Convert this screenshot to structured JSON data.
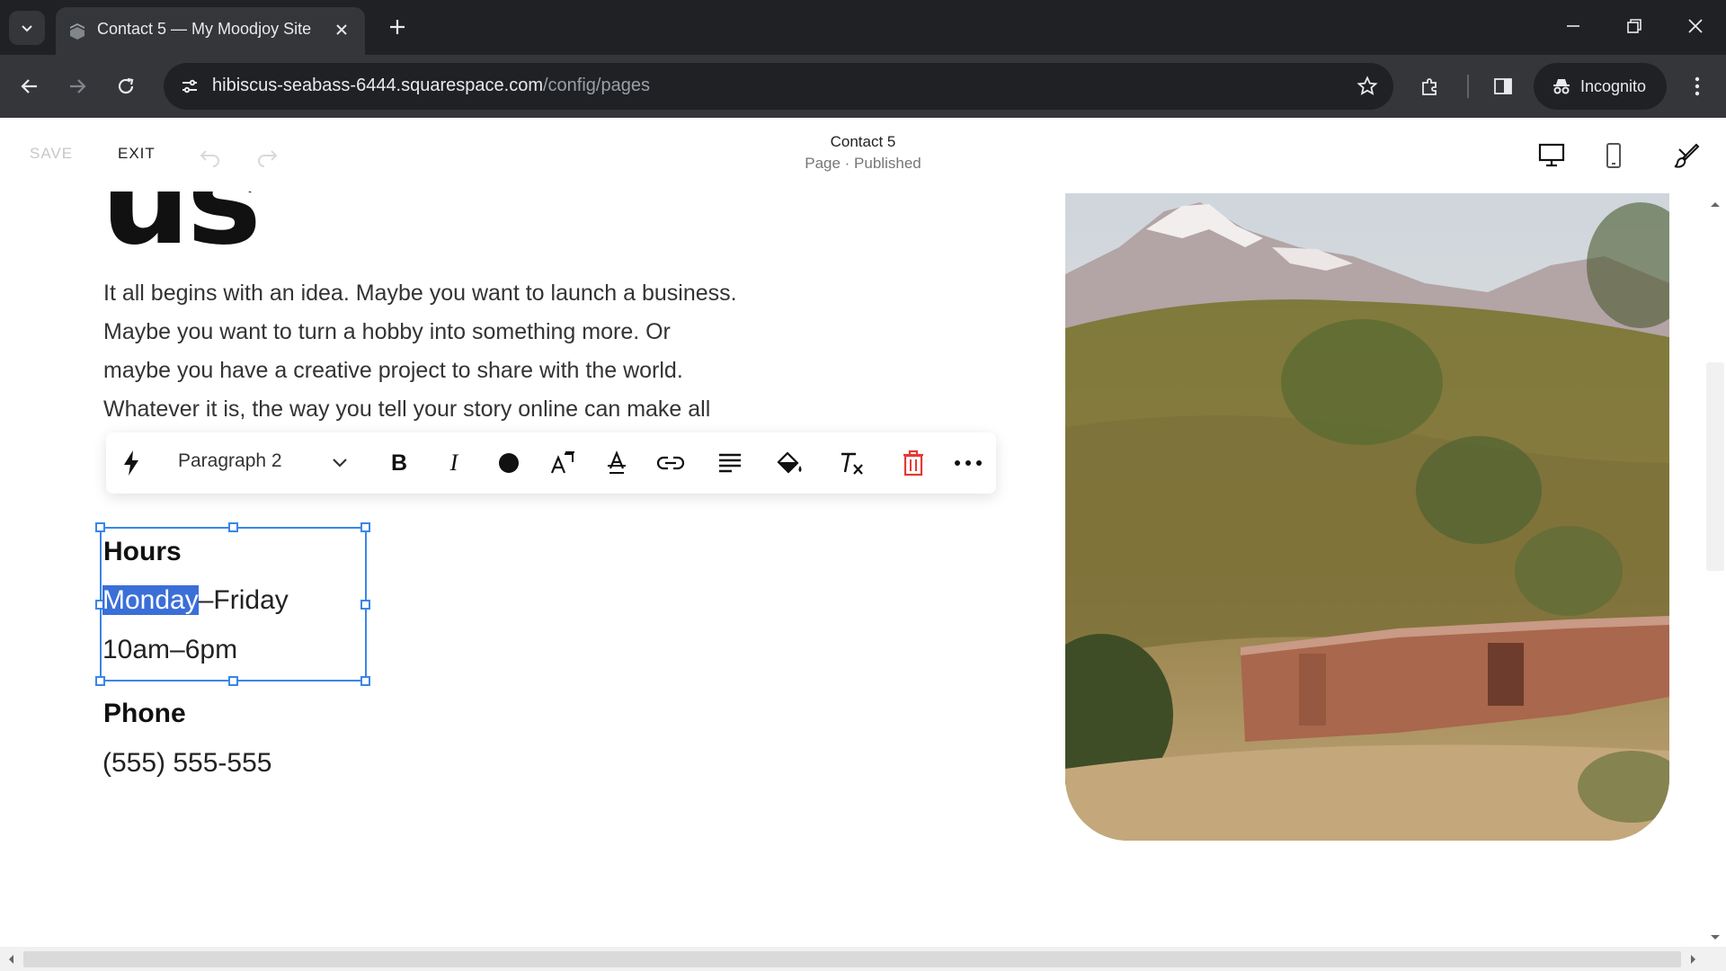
{
  "browser": {
    "tab_title": "Contact 5 — My Moodjoy Site",
    "url_host": "hibiscus-seabass-6444.squarespace.com",
    "url_path": "/config/pages",
    "incognito_label": "Incognito"
  },
  "editor_header": {
    "save_label": "SAVE",
    "exit_label": "EXIT",
    "page_title": "Contact 5",
    "page_status": "Page · Published"
  },
  "content": {
    "heading_fragment": "us",
    "body_lines": [
      "It all begins with an idea. Maybe you want to launch a business.",
      "Maybe you want to turn a hobby into something more. Or",
      "maybe you have a creative project to share with the world.",
      "Whatever it is, the way you tell your story online can make all"
    ],
    "hours_heading": "Hours",
    "hours_days_selected": "Monday",
    "hours_days_rest": "–Friday",
    "hours_time": "10am–6pm",
    "phone_heading": "Phone",
    "phone_number": "(555) 555-555"
  },
  "toolbar": {
    "style_select": "Paragraph 2",
    "tools": [
      "lightning-icon",
      "bold-icon",
      "italic-icon",
      "color-dot-icon",
      "font-size-icon",
      "strikethrough-icon",
      "link-icon",
      "align-icon",
      "highlight-icon",
      "clear-format-icon",
      "delete-icon",
      "more-icon"
    ]
  },
  "colors": {
    "selection": "#3a86e8",
    "highlight": "#3a6fd8",
    "delete_icon": "#e53935"
  }
}
